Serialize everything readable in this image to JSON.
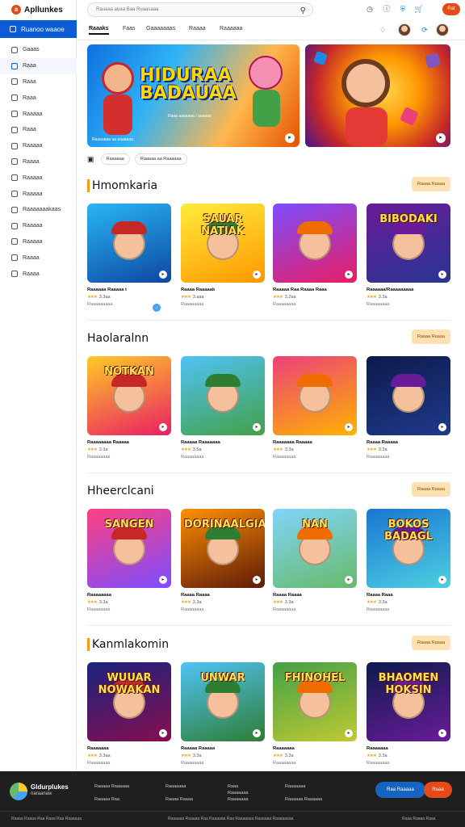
{
  "app": {
    "logo_text": "Apllunkes"
  },
  "sidebar": {
    "active_label": "Ruanoo waaoe",
    "items": [
      {
        "label": "Gaaas",
        "icon": "gamepad-icon"
      },
      {
        "label": "Raaa",
        "icon": "store-icon"
      },
      {
        "label": "Raaa",
        "icon": "tag-icon"
      },
      {
        "label": "Raaa",
        "icon": "info-icon"
      },
      {
        "label": "Raaaaa",
        "icon": "gift-icon"
      },
      {
        "label": "Raaa",
        "icon": "doc-icon"
      },
      {
        "label": "Raaaaa",
        "icon": "chart-icon"
      },
      {
        "label": "Raaaa",
        "icon": "lock-icon"
      },
      {
        "label": "Raaaaa",
        "icon": "gear-icon"
      },
      {
        "label": "Raaaaa",
        "icon": "cloud-icon"
      },
      {
        "label": "Raaaaaaakaas",
        "icon": "star-icon"
      },
      {
        "label": "Raaaaa",
        "icon": "tv-icon"
      },
      {
        "label": "Raaaaa",
        "icon": "globe-icon"
      },
      {
        "label": "Raaaa",
        "icon": "shield-icon"
      },
      {
        "label": "Raaaa",
        "icon": "flag-icon"
      }
    ]
  },
  "topbar": {
    "search_placeholder": "Rauaaa auaa Baa Ruaasaaa",
    "pill_label": "Rat"
  },
  "tabs": [
    {
      "label": "Raaaks"
    },
    {
      "label": "Faas"
    },
    {
      "label": "Gaaaaaaas"
    },
    {
      "label": "Raaaa"
    },
    {
      "label": "Raaaaaa"
    }
  ],
  "banners": [
    {
      "title_line1": "HIDURAA",
      "title_line2": "BADAUAA",
      "subtitle": "Raaa aaaaaaa / aaaaaa",
      "footer": "Raaaaaaa aa aaaaaaa"
    },
    {
      "footer": ""
    }
  ],
  "chips": [
    {
      "label": "Raaaaaa"
    },
    {
      "label": "Raaaaa aa Raaaaaa"
    }
  ],
  "sections": [
    {
      "title": "Hmomkaria",
      "button": "Raaaa Raaaa",
      "cards": [
        {
          "title": "Raaaaaa Raaaaa t",
          "rating": "3.3aa",
          "meta": "Raaaaaaaaa",
          "thumb_word": ""
        },
        {
          "title": "Raaaa Raaaaak",
          "rating": "3.aaa",
          "meta": "Raaaaaaaa",
          "thumb_word": "SAUAR NATIAK"
        },
        {
          "title": "Raaaaa Raa Raaaa Raaa",
          "rating": "3.2aa",
          "meta": "Raaaaaaaa",
          "thumb_word": ""
        },
        {
          "title": "Raaaaaa/Raaaaaaaaa",
          "rating": "3.3a",
          "meta": "Raaaaaaaa",
          "thumb_word": "BIBODAKI"
        }
      ]
    },
    {
      "title": "Haolaralnn",
      "button": "Raaaa Raaaa",
      "cards": [
        {
          "title": "Raaaaaaaa Raaaaa",
          "rating": "3.3a",
          "meta": "Raaaaaaaa",
          "thumb_word": "NOTKAN"
        },
        {
          "title": "Raaaaa Raaaaaaa",
          "rating": "3.5a",
          "meta": "Raaaaaaaa",
          "thumb_word": ""
        },
        {
          "title": "Raaaaaaa Raaaaa",
          "rating": "3.3a",
          "meta": "Raaaaaaaa",
          "thumb_word": ""
        },
        {
          "title": "Raaaa Raaaaa",
          "rating": "3.3a",
          "meta": "Raaaaaaaa",
          "thumb_word": ""
        }
      ]
    },
    {
      "title": "Hheerclcani",
      "button": "Raaaa Raaaa",
      "cards": [
        {
          "title": "Raaaaaaaa",
          "rating": "3.3a",
          "meta": "Raaaaaaaa",
          "thumb_word": "SANGEN"
        },
        {
          "title": "Raaaa Raaaa",
          "rating": "3.3a",
          "meta": "Raaaaaaaa",
          "thumb_word": "DORINAALGIAK"
        },
        {
          "title": "Raaaa Raaaa",
          "rating": "3.3a",
          "meta": "Raaaaaaaa",
          "thumb_word": "NAN"
        },
        {
          "title": "Raaaa Raaa",
          "rating": "3.3a",
          "meta": "Raaaaaaaa",
          "thumb_word": "BOKOS BADAGL"
        }
      ]
    },
    {
      "title": "Kanmlakomin",
      "button": "Raaaa Raaaa",
      "cards": [
        {
          "title": "Raaaaaaa",
          "rating": "3.3aa",
          "meta": "Raaaaaaaa",
          "thumb_word": "WUUAR NOWAKAN"
        },
        {
          "title": "Raaaaa Raaaaa",
          "rating": "3.3a",
          "meta": "Raaaaaaaa",
          "thumb_word": "UNWAR"
        },
        {
          "title": "Raaaaaaa",
          "rating": "3.3a",
          "meta": "Raaaaaaaa",
          "thumb_word": "FHINOHEL"
        },
        {
          "title": "Raaaaaaa",
          "rating": "3.3a",
          "meta": "Raaaaaaaa",
          "thumb_word": "BHAOMEN HOKSIN"
        }
      ]
    }
  ],
  "footer": {
    "brand_line1": "Gldurplukes",
    "brand_line2": "naraanaw",
    "col1": [
      "Raaaaa Raaaaaa",
      "Raaaaa Raa"
    ],
    "col2": [
      "Raaaaaaa",
      "Raaaa Raaaa"
    ],
    "col3": [
      "Raaa",
      "Raaaaaaa",
      "Raaaaaaa"
    ],
    "col4": [
      "Raaaaaaa",
      "Raaaaaa Raaaaaa"
    ],
    "btn_blue": "Raa  Raaaaa",
    "btn_orange": "Raaa",
    "bottom_left": "Raaaa Raaaa Raa Raaa Raa Raaaaaa",
    "bottom_center": "Raaaaaa Raaaaa Raa Raaaaaa Raa Raaaaaaa Raaaaaa Raaaaaaaa",
    "bottom_right": "Raaa Raaaa Raaa"
  }
}
